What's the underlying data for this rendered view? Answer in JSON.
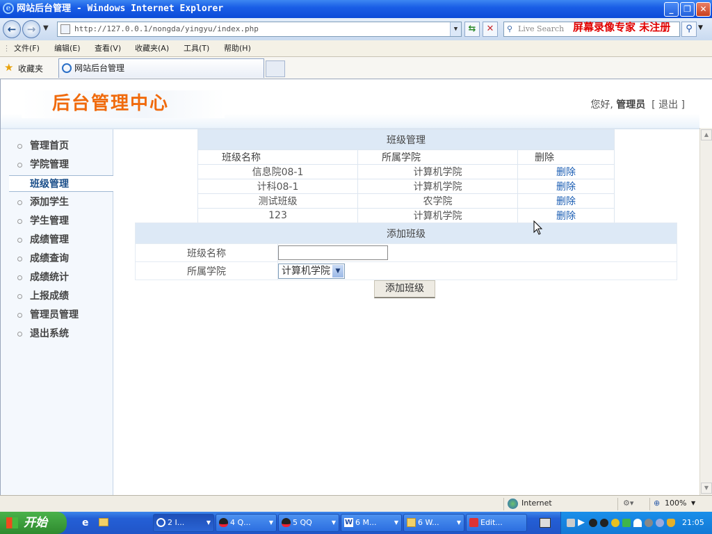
{
  "window": {
    "title": "网站后台管理 - Windows Internet Explorer"
  },
  "browser": {
    "url": "http://127.0.0.1/nongda/yingyu/index.php",
    "search_placeholder": "Live Search",
    "watermark": "屏幕录像专家  未注册",
    "menu": [
      "文件(F)",
      "编辑(E)",
      "查看(V)",
      "收藏夹(A)",
      "工具(T)",
      "帮助(H)"
    ],
    "favorites_label": "收藏夹",
    "tab_title": "网站后台管理",
    "status_zone": "Internet",
    "zoom": "100%"
  },
  "page": {
    "logo_title": "后台管理中心",
    "greeting": "您好,",
    "user": "管理员",
    "logout": "[ 退出 ]"
  },
  "sidebar": {
    "items": [
      {
        "label": "管理首页"
      },
      {
        "label": "学院管理"
      },
      {
        "label": "班级管理"
      },
      {
        "label": "添加学生"
      },
      {
        "label": "学生管理"
      },
      {
        "label": "成绩管理"
      },
      {
        "label": "成绩查询"
      },
      {
        "label": "成绩统计"
      },
      {
        "label": "上报成绩"
      },
      {
        "label": "管理员管理"
      },
      {
        "label": "退出系统"
      }
    ],
    "active_index": 2
  },
  "class_table": {
    "caption": "班级管理",
    "headers": [
      "班级名称",
      "所属学院",
      "删除"
    ],
    "rows": [
      {
        "name": "信息院08-1",
        "college": "计算机学院",
        "action": "删除"
      },
      {
        "name": "计科08-1",
        "college": "计算机学院",
        "action": "删除"
      },
      {
        "name": "测试班级",
        "college": "农学院",
        "action": "删除"
      },
      {
        "name": "123",
        "college": "计算机学院",
        "action": "删除"
      }
    ]
  },
  "add_form": {
    "caption": "添加班级",
    "name_label": "班级名称",
    "name_value": "",
    "college_label": "所属学院",
    "college_selected": "计算机学院",
    "submit_label": "添加班级"
  },
  "taskbar": {
    "start_label": "开始",
    "tasks": [
      {
        "label": "2 I..."
      },
      {
        "label": "4 Q..."
      },
      {
        "label": "5 QQ"
      },
      {
        "label": "6 M..."
      },
      {
        "label": "6 W..."
      },
      {
        "label": "Edit..."
      }
    ],
    "clock": "21:05"
  },
  "colors": {
    "brand_orange": "#f06a0c",
    "link_blue": "#1a5db3",
    "table_caption_bg": "#dde9f6",
    "xp_title_blue": "#1a5ee6",
    "start_green": "#2f8a2f"
  }
}
